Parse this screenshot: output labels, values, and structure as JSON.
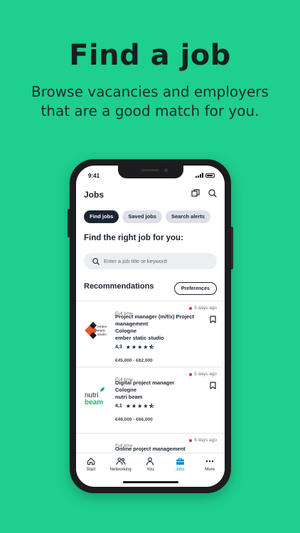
{
  "promo": {
    "title": "Find a job",
    "subtitle": "Browse vacancies and employers that are a good match for you."
  },
  "status_bar": {
    "time": "9:41"
  },
  "header": {
    "title": "Jobs",
    "icons": [
      "compare-icon",
      "search-icon"
    ]
  },
  "tabs": [
    {
      "label": "Find jobs",
      "active": true
    },
    {
      "label": "Saved jobs",
      "active": false
    },
    {
      "label": "Search alerts",
      "active": false
    }
  ],
  "search": {
    "heading": "Find the right job for you:",
    "placeholder": "Enter a job title or keyword"
  },
  "recommendations": {
    "heading": "Recommendations",
    "preferences_label": "Preferences",
    "jobs": [
      {
        "type": "Full time",
        "posted": "5 days ago",
        "title": "Project manager (m/f/x) Project management",
        "city": "Cologne",
        "company": "ember static studio",
        "logo_text": "ember static studio",
        "rating": "4,3",
        "stars": "★★★★⯪",
        "salary": "€45,000 - €62,000"
      },
      {
        "type": "Full time",
        "posted": "5 days ago",
        "title": "Digital project manager",
        "city": "Cologne",
        "company": "nutri beam",
        "logo_text_top": "nutri",
        "logo_text_bottom": "beam",
        "rating": "4,1",
        "stars": "★★★★⯪",
        "salary": "€49,000 - €66,000"
      },
      {
        "type": "Full time",
        "posted": "6 days ago",
        "title": "Online project management"
      }
    ]
  },
  "tabbar": [
    {
      "label": "Start",
      "icon": "home-icon",
      "active": false
    },
    {
      "label": "Networking",
      "icon": "people-icon",
      "active": false
    },
    {
      "label": "You",
      "icon": "person-icon",
      "active": false
    },
    {
      "label": "Jobs",
      "icon": "briefcase-icon",
      "active": true
    },
    {
      "label": "More",
      "icon": "more-icon",
      "active": false
    }
  ],
  "colors": {
    "background": "#1ecf8f",
    "dark": "#1b2432",
    "accent": "#1a8ec9",
    "new_dot": "#e0245e",
    "ember_orange": "#e8562a",
    "nutri_green": "#1db36b"
  }
}
